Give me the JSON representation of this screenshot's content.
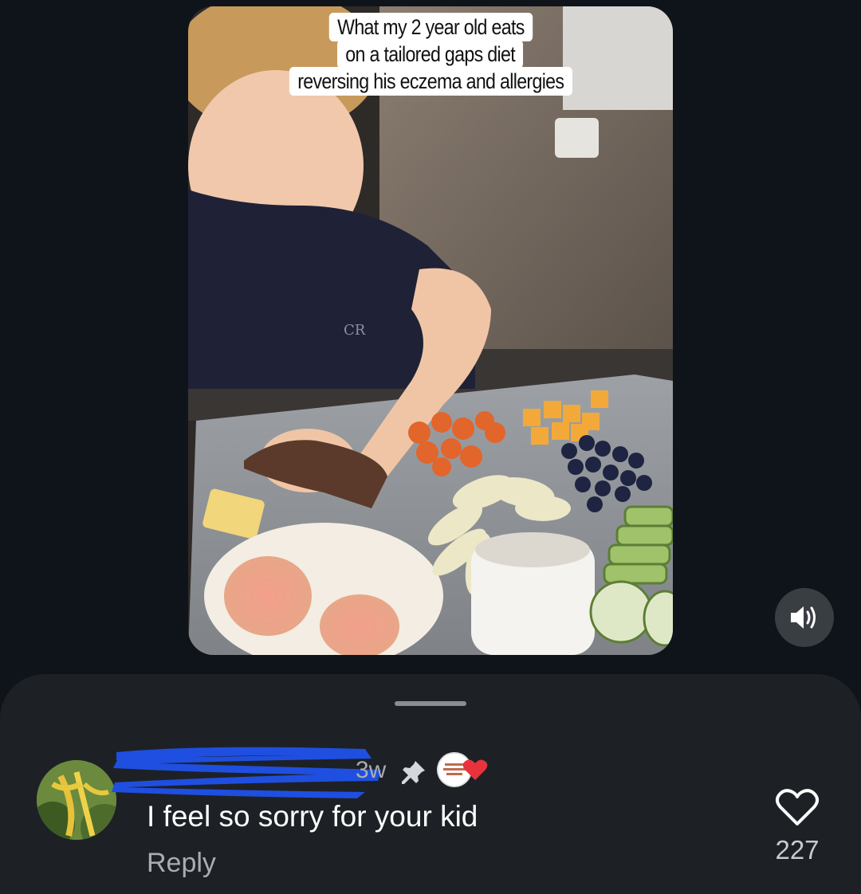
{
  "video": {
    "caption_lines": [
      "What my 2 year old eats",
      "on a tailored gaps diet",
      "reversing his eczema and allergies"
    ],
    "shirt_logo_text": "CR"
  },
  "volume_button": {
    "icon": "speaker-on-icon"
  },
  "comment": {
    "username_redacted": true,
    "time": "3w",
    "pinned_icon": "pin-icon",
    "creator_liked_icon": "red-heart-icon",
    "text": "I feel so sorry for your kid",
    "reply_label": "Reply",
    "like_count": "227",
    "like_icon": "heart-outline-icon"
  },
  "colors": {
    "background": "#0f141a",
    "sheet": "#1d2126",
    "heart_red": "#e8333c",
    "redact_blue": "#1f4fe0"
  }
}
